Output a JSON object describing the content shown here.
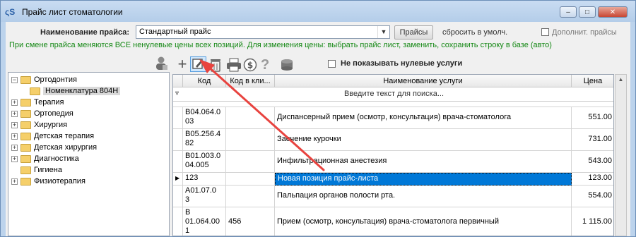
{
  "window": {
    "title": "Прайс лист стоматологии",
    "app_icon": "ςS",
    "buttons": [
      "–",
      "□",
      "✕"
    ]
  },
  "toolbar_top": {
    "price_name_label": "Наименование прайса:",
    "price_name_value": "Стандартный прайс",
    "prices_button": "Прайсы",
    "reset_link": "сбросить в умолч.",
    "extra_prices_label": "Дополнит. прайсы"
  },
  "notice": "При смене прайса меняются ВСЕ ненулевые цены всех позиций. Для изменения цены: выбрать прайс лист, заменить, сохранить строку в базе (авто)",
  "grid_toolbar": {
    "icons": [
      "add-icon",
      "edit-icon",
      "delete-icon",
      "print-icon",
      "price-icon",
      "help-icon",
      "coins-icon"
    ],
    "hide_zero_label": "Не показывать нулевые услуги"
  },
  "tree": {
    "items": [
      {
        "label": "Ортодонтия",
        "expander": "−",
        "level": 0
      },
      {
        "label": "Номенклатура 804Н",
        "expander": "",
        "level": 1,
        "selected": true
      },
      {
        "label": "Терапия",
        "expander": "+",
        "level": 0
      },
      {
        "label": "Ортопедия",
        "expander": "+",
        "level": 0
      },
      {
        "label": "Хирургия",
        "expander": "+",
        "level": 0
      },
      {
        "label": "Детская терапия",
        "expander": "+",
        "level": 0
      },
      {
        "label": "Детская хирургия",
        "expander": "+",
        "level": 0
      },
      {
        "label": "Диагностика",
        "expander": "+",
        "level": 0
      },
      {
        "label": "Гигиена",
        "expander": "",
        "level": 0
      },
      {
        "label": "Физиотерапия",
        "expander": "+",
        "level": 0
      }
    ]
  },
  "grid": {
    "columns": [
      "Код",
      "Код в кли...",
      "Наименование услуги",
      "Цена"
    ],
    "search_placeholder": "Введите текст для поиска...",
    "rows": [
      {
        "code": "B04.064.0\n03",
        "clinic_code": "",
        "name": "Диспансерный прием (осмотр, консультация) врача-стоматолога",
        "price": "551.00"
      },
      {
        "code": "B05.256.4\n82",
        "clinic_code": "",
        "name": "Заечение курочки",
        "price": "731.00"
      },
      {
        "code": "B01.003.0\n04.005",
        "clinic_code": "",
        "name": "Инфильтрационная анестезия",
        "price": "543.00"
      },
      {
        "code": "123",
        "clinic_code": "",
        "name": "Новая позиция прайс-листа",
        "price": "123.00",
        "current": true
      },
      {
        "code": "A01.07.0\n3",
        "clinic_code": "",
        "name": "Пальпация органов полости рта.",
        "price": "554.00"
      },
      {
        "code": "B\n01.064.00\n1",
        "clinic_code": "456",
        "name": "Прием (осмотр, консультация) врача-стоматолога первичный",
        "price": "1 115.00"
      }
    ]
  },
  "colors": {
    "accent": "#0078d7",
    "notice": "#148814",
    "arrow": "#e8433f"
  }
}
